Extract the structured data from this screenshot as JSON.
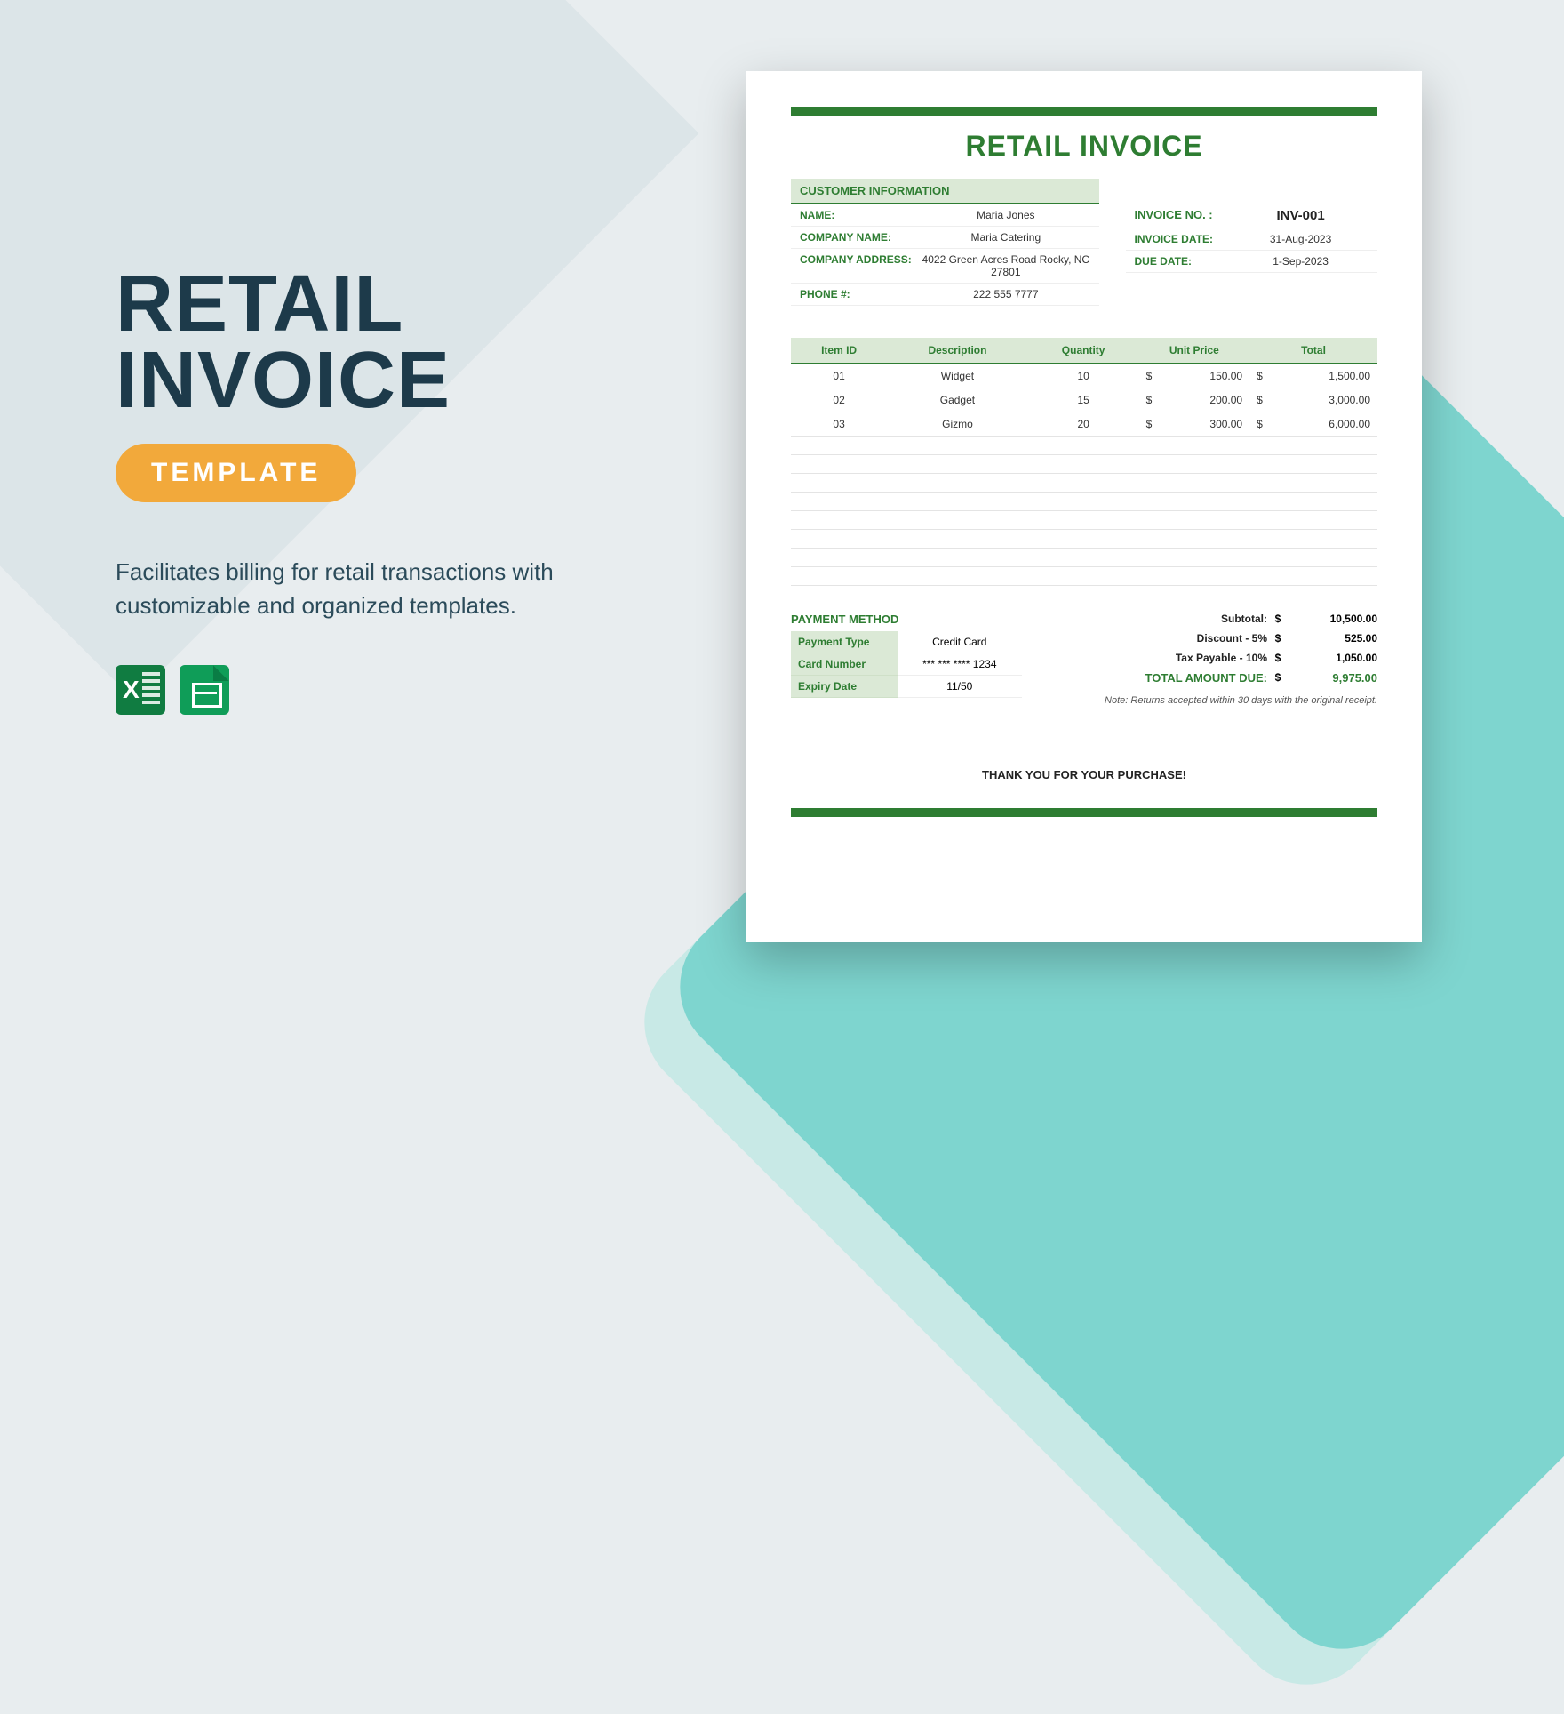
{
  "promo": {
    "title_line1": "RETAIL",
    "title_line2": "INVOICE",
    "badge": "TEMPLATE",
    "description": "Facilitates billing for retail transactions with customizable and organized templates."
  },
  "document": {
    "title": "RETAIL INVOICE",
    "customer_section_header": "CUSTOMER INFORMATION",
    "customer": {
      "name_label": "NAME:",
      "name_value": "Maria Jones",
      "company_label": "COMPANY NAME:",
      "company_value": "Maria Catering",
      "address_label": "COMPANY ADDRESS:",
      "address_value": "4022 Green Acres Road Rocky, NC 27801",
      "phone_label": "PHONE #:",
      "phone_value": "222 555 7777"
    },
    "invoice_meta": {
      "no_label": "INVOICE NO. :",
      "no_value": "INV-001",
      "date_label": "INVOICE DATE:",
      "date_value": "31-Aug-2023",
      "due_label": "DUE DATE:",
      "due_value": "1-Sep-2023"
    },
    "items_header": {
      "id": "Item ID",
      "desc": "Description",
      "qty": "Quantity",
      "unit": "Unit Price",
      "total": "Total"
    },
    "items": [
      {
        "id": "01",
        "desc": "Widget",
        "qty": "10",
        "unit": "150.00",
        "total": "1,500.00"
      },
      {
        "id": "02",
        "desc": "Gadget",
        "qty": "15",
        "unit": "200.00",
        "total": "3,000.00"
      },
      {
        "id": "03",
        "desc": "Gizmo",
        "qty": "20",
        "unit": "300.00",
        "total": "6,000.00"
      }
    ],
    "currency": "$",
    "payment_header": "PAYMENT METHOD",
    "payment": {
      "type_label": "Payment Type",
      "type_value": "Credit Card",
      "card_label": "Card Number",
      "card_value": "*** *** **** 1234",
      "expiry_label": "Expiry Date",
      "expiry_value": "11/50"
    },
    "totals": {
      "subtotal_label": "Subtotal:",
      "subtotal_value": "10,500.00",
      "discount_label": "Discount - 5%",
      "discount_value": "525.00",
      "tax_label": "Tax Payable - 10%",
      "tax_value": "1,050.00",
      "due_label": "TOTAL AMOUNT DUE:",
      "due_value": "9,975.00"
    },
    "note": "Note: Returns accepted within 30 days with the original receipt.",
    "thanks": "THANK YOU FOR YOUR PURCHASE!"
  }
}
